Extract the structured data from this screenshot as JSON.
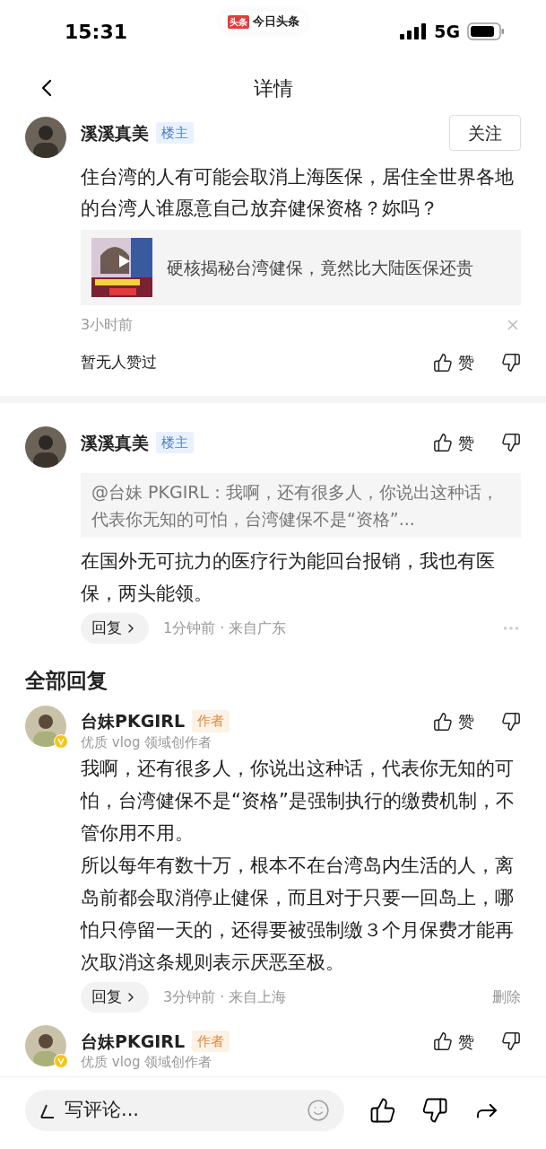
{
  "status_bar": {
    "time": "15:31",
    "app_badge": "头条",
    "app_name": "今日头条",
    "network": "5G"
  },
  "nav": {
    "title": "详情"
  },
  "main_comment": {
    "author": "溪溪真美",
    "tag": "楼主",
    "follow_button": "关注",
    "text": "住台湾的人有可能会取消上海医保，居住全世界各地的台湾人谁愿意自己放弃健保资格？妳吗？",
    "video_link": {
      "title": "硬核揭秘台湾健保，竟然比大陆医保还贵"
    },
    "time": "3小时前",
    "likes_text": "暂无人赞过",
    "like_label": "赞"
  },
  "reply": {
    "author": "溪溪真美",
    "tag": "楼主",
    "like_label": "赞",
    "quote": "@台妹 PKGIRL：我啊，还有很多人，你说出这种话，代表你无知的可怕，台湾健保不是“资格”...",
    "text": "在国外无可抗力的医疗行为能回台报销，我也有医保，两头能领。",
    "reply_button": "回复",
    "meta": "1分钟前 · 来自广东"
  },
  "section_title": "全部回复",
  "replies": [
    {
      "author": "台妹PKGIRL",
      "tag": "作者",
      "subtitle": "优质 vlog 领域创作者",
      "like_label": "赞",
      "paragraphs": [
        "我啊，还有很多人，你说出这种话，代表你无知的可怕，台湾健保不是“资格”是强制执行的缴费机制，不管你用不用。",
        "所以每年有数十万，根本不在台湾岛内生活的人，离岛前都会取消停止健保，而且对于只要一回岛上，哪怕只停留一天的，还得要被强制缴３个月保费才能再次取消这条规则表示厌恶至极。"
      ],
      "reply_button": "回复",
      "meta": "3分钟前 · 来自上海",
      "delete_label": "删除"
    },
    {
      "author": "台妹PKGIRL",
      "tag": "作者",
      "subtitle": "优质 vlog 领域创作者",
      "like_label": "赞"
    }
  ],
  "bottom_bar": {
    "placeholder": "写评论..."
  }
}
